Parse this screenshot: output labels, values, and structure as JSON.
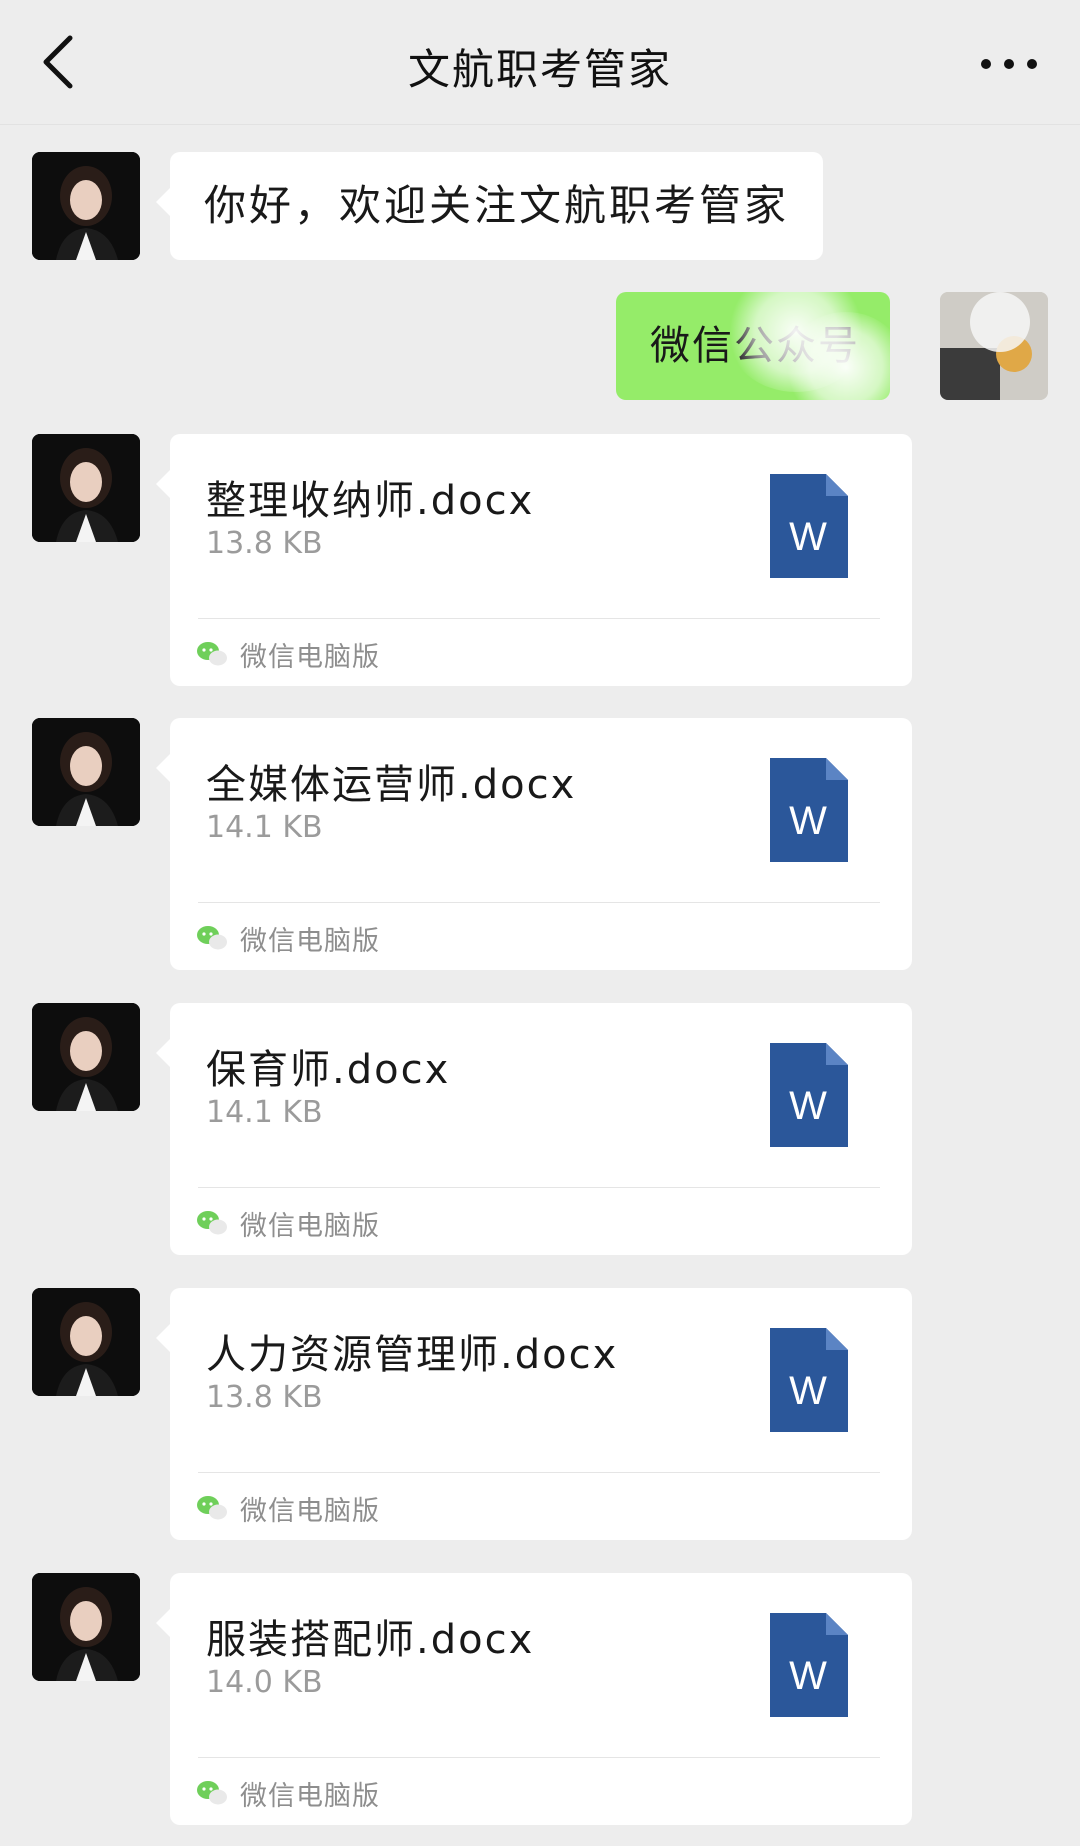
{
  "header": {
    "title": "文航职考管家",
    "back_icon": "chevron-left-icon",
    "more_icon": "more-dots-icon"
  },
  "messages": {
    "greeting": "你好，欢迎关注文航职考管家",
    "sent_text": "微信公众号",
    "files": [
      {
        "name": "整理收纳师.docx",
        "size": "13.8 KB",
        "source": "微信电脑版"
      },
      {
        "name": "全媒体运营师.docx",
        "size": "14.1 KB",
        "source": "微信电脑版"
      },
      {
        "name": "保育师.docx",
        "size": "14.1 KB",
        "source": "微信电脑版"
      },
      {
        "name": "人力资源管理师.docx",
        "size": "13.8 KB",
        "source": "微信电脑版"
      },
      {
        "name": "服装搭配师.docx",
        "size": "14.0 KB",
        "source": "微信电脑版"
      }
    ]
  },
  "icons": {
    "file_icon_letter": "W"
  },
  "colors": {
    "background": "#ededed",
    "bubble": "#ffffff",
    "sent_bubble": "#95ec69",
    "word_blue": "#2b579a",
    "meta_gray": "#9b9b9b"
  }
}
